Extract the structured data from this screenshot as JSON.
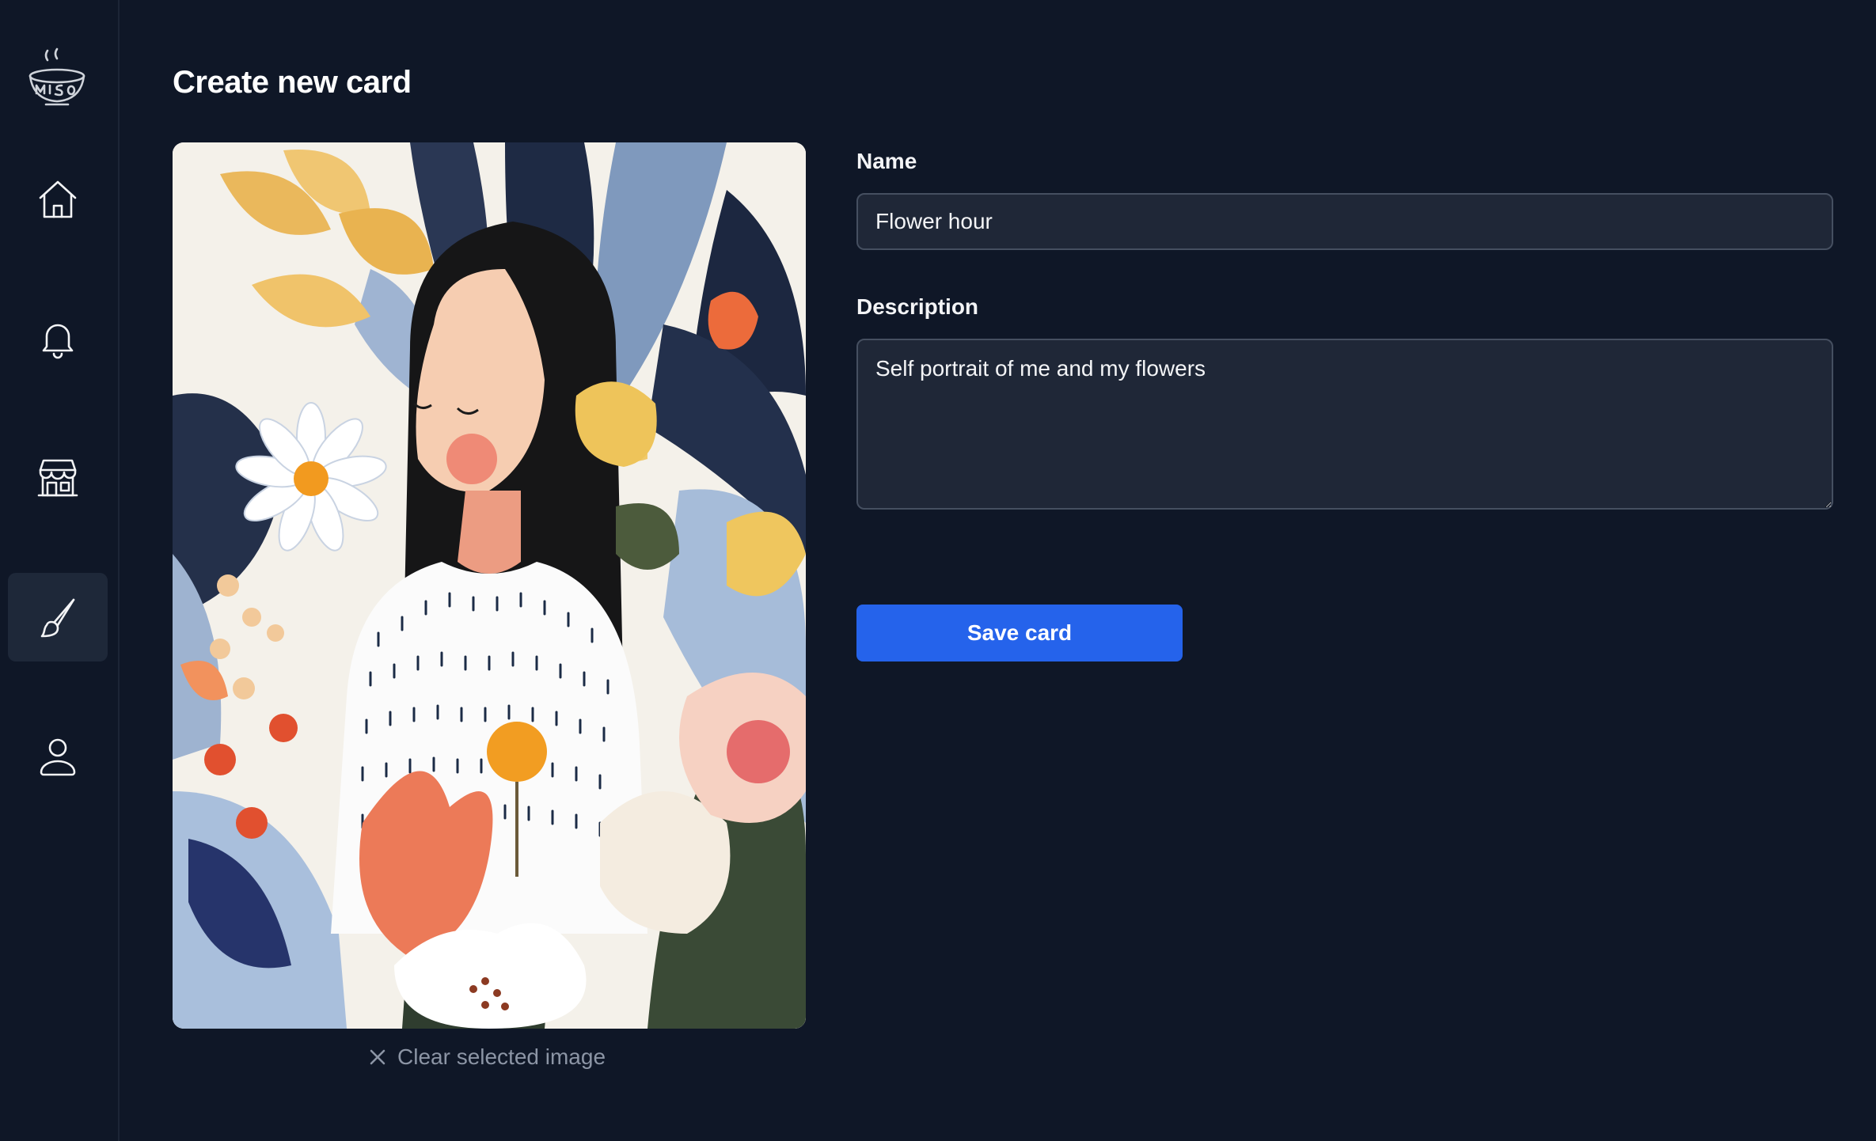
{
  "sidebar": {
    "items": [
      {
        "name": "home",
        "icon": "home-icon"
      },
      {
        "name": "notifications",
        "icon": "bell-icon"
      },
      {
        "name": "store",
        "icon": "store-icon"
      },
      {
        "name": "create",
        "icon": "brush-icon",
        "active": true
      },
      {
        "name": "profile",
        "icon": "user-icon"
      }
    ],
    "logo_icon": "miso-bowl-logo"
  },
  "page": {
    "title": "Create new card"
  },
  "image": {
    "clear_label": "Clear selected image",
    "clear_icon": "close-icon"
  },
  "form": {
    "name_label": "Name",
    "name_value": "Flower hour",
    "description_label": "Description",
    "description_value": "Self portrait of me and my flowers",
    "save_label": "Save card"
  },
  "colors": {
    "background": "#0f1727",
    "input_background": "#1f2737",
    "accent": "#2563eb",
    "sidebar_active": "#1e2839"
  }
}
